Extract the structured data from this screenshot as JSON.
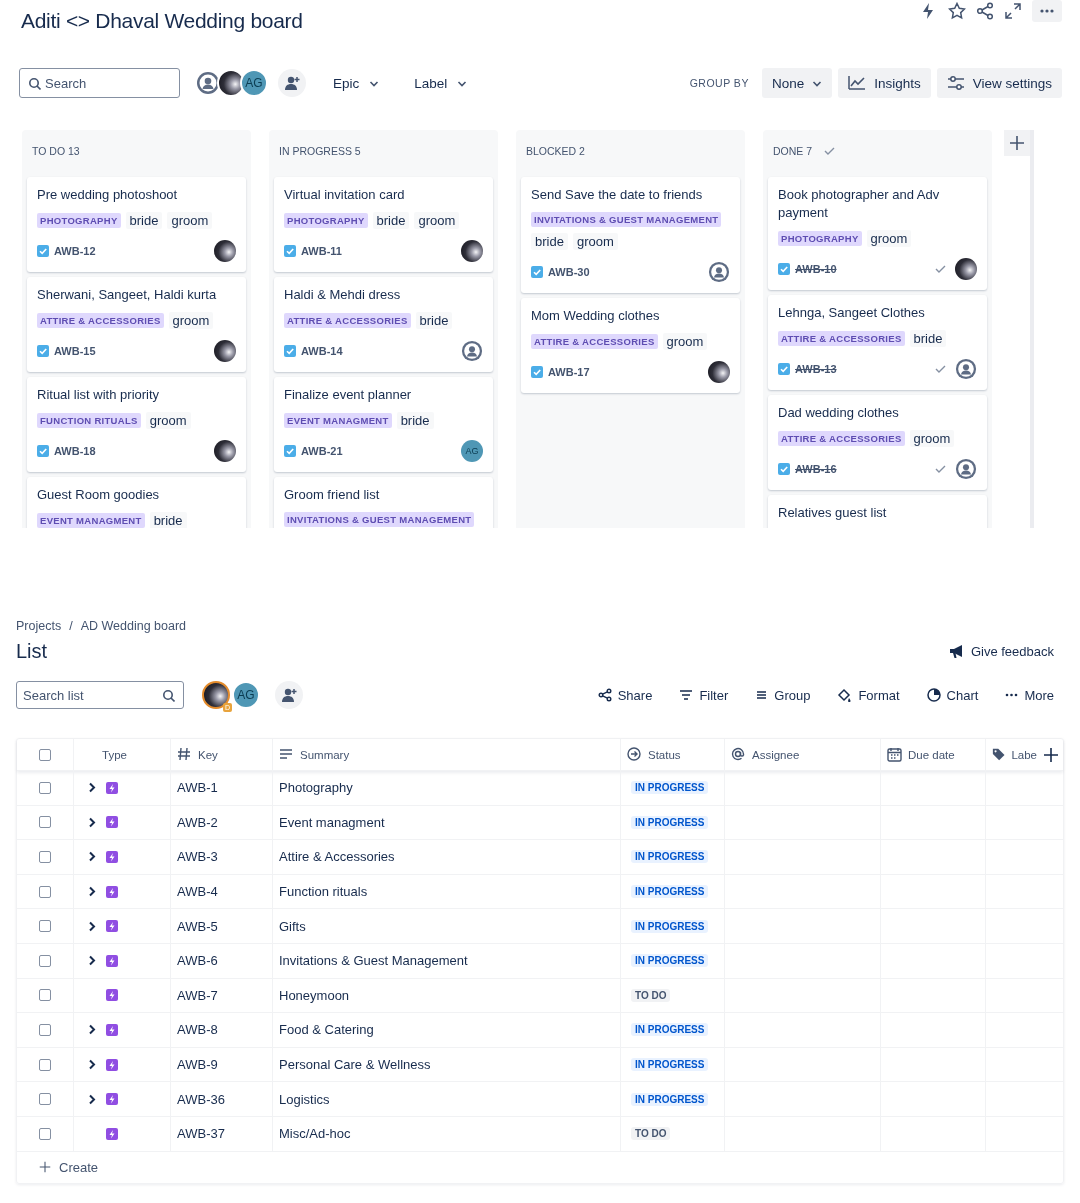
{
  "board": {
    "title": "Aditi <> Dhaval Wedding board",
    "toolbar": {
      "search": {
        "placeholder": "Search"
      },
      "avatars": [
        {
          "kind": "person"
        },
        {
          "kind": "photo"
        },
        {
          "kind": "initials",
          "initials": "AG"
        }
      ],
      "filters": [
        "Epic",
        "Label"
      ],
      "group_by_label": "GROUP BY",
      "group_by": "None",
      "buttons": [
        "Insights",
        "View settings"
      ]
    },
    "columns": [
      {
        "title": "TO DO 13",
        "kind": "open",
        "cards": [
          {
            "title": "Pre wedding photoshoot",
            "epic": "PHOTOGRAPHY",
            "labels": [
              "bride",
              "groom"
            ],
            "key": "AWB-12",
            "done": false,
            "assignee": {
              "kind": "photo"
            }
          },
          {
            "title": "Sherwani, Sangeet, Haldi kurta",
            "epic": "ATTIRE & ACCESSORIES",
            "labels": [
              "groom"
            ],
            "key": "AWB-15",
            "done": false,
            "assignee": {
              "kind": "photo"
            }
          },
          {
            "title": "Ritual list with priority",
            "epic": "FUNCTION RITUALS",
            "labels": [
              "groom"
            ],
            "key": "AWB-18",
            "done": false,
            "assignee": {
              "kind": "photo"
            }
          },
          {
            "title": "Guest Room goodies",
            "epic": "EVENT MANAGMENT",
            "labels": [
              "bride"
            ]
          }
        ]
      },
      {
        "title": "IN PROGRESS 5",
        "kind": "open",
        "cards": [
          {
            "title": "Virtual invitation card",
            "epic": "PHOTOGRAPHY",
            "labels": [
              "bride",
              "groom"
            ],
            "key": "AWB-11",
            "done": false,
            "assignee": {
              "kind": "photo"
            }
          },
          {
            "title": "Haldi & Mehdi dress",
            "epic": "ATTIRE & ACCESSORIES",
            "labels": [
              "bride"
            ],
            "key": "AWB-14",
            "done": false,
            "assignee": {
              "kind": "person"
            }
          },
          {
            "title": "Finalize event planner",
            "epic": "EVENT MANAGMENT",
            "labels": [
              "bride"
            ],
            "key": "AWB-21",
            "done": false,
            "assignee": {
              "kind": "initials",
              "initials": "AG"
            }
          },
          {
            "title": "Groom friend list",
            "epic": "INVITATIONS & GUEST MANAGEMENT"
          }
        ]
      },
      {
        "title": "BLOCKED 2",
        "kind": "open",
        "cards": [
          {
            "title": "Send Save the date to friends",
            "epic": "INVITATIONS & GUEST MANAGEMENT",
            "labels": [
              "bride",
              "groom"
            ],
            "key": "AWB-30",
            "done": false,
            "assignee": {
              "kind": "person"
            }
          },
          {
            "title": "Mom Wedding clothes",
            "epic": "ATTIRE & ACCESSORIES",
            "labels": [
              "groom"
            ],
            "key": "AWB-17",
            "done": false,
            "assignee": {
              "kind": "photo"
            }
          }
        ]
      },
      {
        "title": "DONE 7",
        "kind": "done",
        "cards": [
          {
            "title": "Book photographer and Adv payment",
            "epic": "PHOTOGRAPHY",
            "labels": [
              "groom"
            ],
            "key": "AWB-10",
            "done": true,
            "assignee": {
              "kind": "photo"
            }
          },
          {
            "title": "Lehnga, Sangeet Clothes",
            "epic": "ATTIRE & ACCESSORIES",
            "labels": [
              "bride"
            ],
            "key": "AWB-13",
            "done": true,
            "assignee": {
              "kind": "person"
            }
          },
          {
            "title": "Dad wedding clothes",
            "epic": "ATTIRE & ACCESSORIES",
            "labels": [
              "groom"
            ],
            "key": "AWB-16",
            "done": true,
            "assignee": {
              "kind": "person"
            }
          },
          {
            "title": "Relatives guest list"
          }
        ]
      }
    ]
  },
  "list": {
    "breadcrumbs": [
      "Projects",
      "AD Wedding board"
    ],
    "breadcrumb_separator": "/",
    "title": "List",
    "feedback": "Give feedback",
    "search": {
      "placeholder": "Search list"
    },
    "avatars": [
      {
        "kind": "photo",
        "badge": "D"
      },
      {
        "kind": "initials",
        "initials": "AG"
      }
    ],
    "actions": [
      "Share",
      "Filter",
      "Group",
      "Format",
      "Chart",
      "More"
    ],
    "table": {
      "select_all": {
        "checked": false
      },
      "columns": [
        "Type",
        "Key",
        "Summary",
        "Status",
        "Assignee",
        "Due date",
        "Labe"
      ],
      "rows": [
        {
          "key": "AWB-1",
          "summary": "Photography",
          "status": "IN PROGRESS",
          "kind": "in_progress",
          "expandable": true,
          "checked": false
        },
        {
          "key": "AWB-2",
          "summary": "Event managment",
          "status": "IN PROGRESS",
          "kind": "in_progress",
          "expandable": true,
          "checked": false
        },
        {
          "key": "AWB-3",
          "summary": "Attire & Accessories",
          "status": "IN PROGRESS",
          "kind": "in_progress",
          "expandable": true,
          "checked": false
        },
        {
          "key": "AWB-4",
          "summary": "Function rituals",
          "status": "IN PROGRESS",
          "kind": "in_progress",
          "expandable": true,
          "checked": false
        },
        {
          "key": "AWB-5",
          "summary": "Gifts",
          "status": "IN PROGRESS",
          "kind": "in_progress",
          "expandable": true,
          "checked": false
        },
        {
          "key": "AWB-6",
          "summary": "Invitations & Guest Management",
          "status": "IN PROGRESS",
          "kind": "in_progress",
          "expandable": true,
          "checked": false
        },
        {
          "key": "AWB-7",
          "summary": "Honeymoon",
          "status": "TO DO",
          "kind": "todo",
          "expandable": false,
          "checked": false
        },
        {
          "key": "AWB-8",
          "summary": "Food & Catering",
          "status": "IN PROGRESS",
          "kind": "in_progress",
          "expandable": true,
          "checked": false
        },
        {
          "key": "AWB-9",
          "summary": "Personal Care & Wellness",
          "status": "IN PROGRESS",
          "kind": "in_progress",
          "expandable": true,
          "checked": false
        },
        {
          "key": "AWB-36",
          "summary": "Logistics",
          "status": "IN PROGRESS",
          "kind": "in_progress",
          "expandable": true,
          "checked": false
        },
        {
          "key": "AWB-37",
          "summary": "Misc/Ad-hoc",
          "status": "TO DO",
          "kind": "todo",
          "expandable": false,
          "checked": false
        }
      ],
      "create": "Create"
    }
  }
}
